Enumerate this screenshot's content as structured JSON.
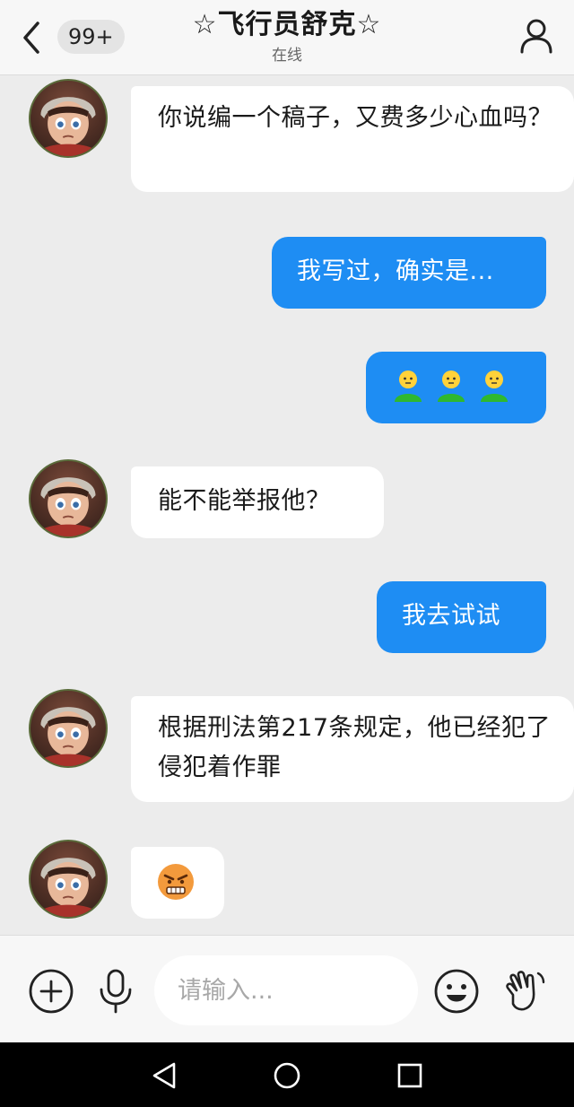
{
  "header": {
    "back_icon": "chevron-left-icon",
    "unread_badge": "99+",
    "title": "☆飞行员舒克☆",
    "status": "在线",
    "profile_icon": "person-icon"
  },
  "messages": [
    {
      "side": "in",
      "text": "你说编一个稿子，又费多少心血吗？"
    },
    {
      "side": "out",
      "text": "我写过，确实是..."
    },
    {
      "side": "out",
      "emoji": [
        "green-person-emoji",
        "green-person-emoji",
        "green-person-emoji"
      ]
    },
    {
      "side": "in",
      "text": "能不能举报他？"
    },
    {
      "side": "out",
      "text": "我去试试"
    },
    {
      "side": "in",
      "text": "根据刑法第217条规定，他已经犯了侵犯着作罪"
    },
    {
      "side": "in",
      "emoji": [
        "angry-face-emoji"
      ]
    }
  ],
  "input_bar": {
    "plus_icon": "plus-circle-icon",
    "voice_icon": "microphone-icon",
    "placeholder": "请输入...",
    "emoji_icon": "smiley-icon",
    "gesture_icon": "hand-wave-icon"
  },
  "system_nav": {
    "back": "triangle-back-icon",
    "home": "circle-home-icon",
    "recents": "square-recents-icon"
  },
  "colors": {
    "accent_blue": "#1e8df3",
    "background": "#ececec",
    "header_bg": "#f7f7f7"
  }
}
